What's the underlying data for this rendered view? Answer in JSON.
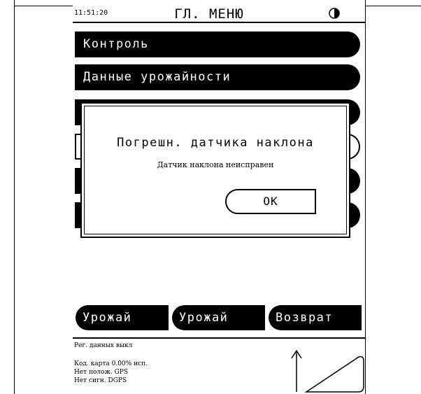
{
  "status": {
    "time": "11:51:20",
    "title": "ГЛ. МЕНЮ",
    "contrast_icon": "contrast-icon"
  },
  "menu": {
    "items": [
      {
        "label": "Контроль"
      },
      {
        "label": "Данные урожайности"
      }
    ]
  },
  "dialog": {
    "title": "Погрешн. датчика наклона",
    "message": "Датчик наклона неисправен",
    "ok_label": "OK"
  },
  "softkeys": [
    {
      "label": "Урожай"
    },
    {
      "label": "Урожай"
    },
    {
      "label": "Возврат"
    }
  ],
  "info": {
    "logging": "Рег. данных выкл",
    "card": "Код. карта   0.00% исп.",
    "position": "Нет полож. GPS",
    "dgps": "Нет сигн. DGPS"
  },
  "colors": {
    "foreground": "#000000",
    "background": "#ffffff"
  }
}
